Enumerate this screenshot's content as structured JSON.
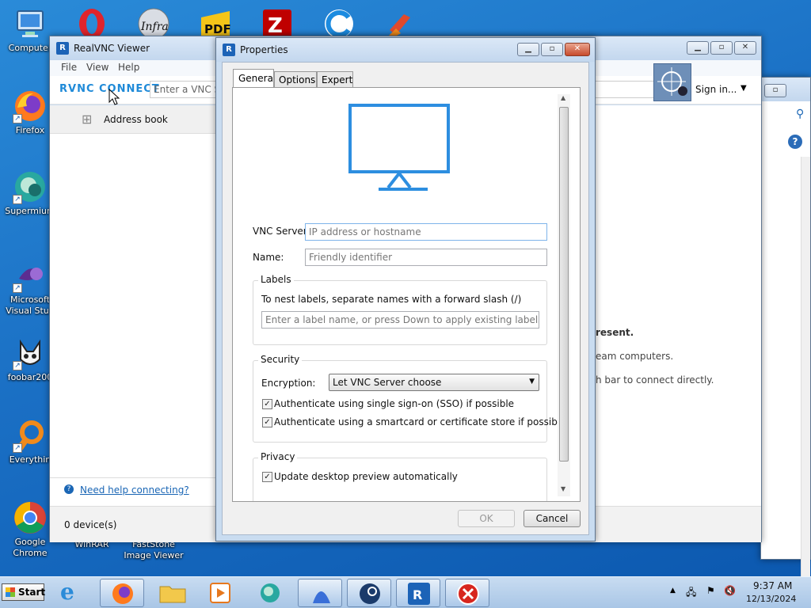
{
  "desktop": {
    "icons": [
      {
        "label": "Computer",
        "glyph": "🖥"
      },
      {
        "label": "Firefox",
        "glyph": ""
      },
      {
        "label": "Supermium",
        "glyph": ""
      },
      {
        "label": "Microsoft Visual Stud",
        "glyph": ""
      },
      {
        "label": "foobar200",
        "glyph": ""
      },
      {
        "label": "Everythin",
        "glyph": ""
      },
      {
        "label": "Google Chrome",
        "glyph": ""
      },
      {
        "label": "WinRAR",
        "glyph": ""
      },
      {
        "label": "FastStone Image Viewer",
        "glyph": ""
      }
    ],
    "top_icons": [
      "opera-icon",
      "infra-icon",
      "pdf-icon",
      "filezilla-icon",
      "ccleaner-browser-icon",
      "ccleaner-icon"
    ]
  },
  "viewer": {
    "title": "RealVNC Viewer",
    "menu": [
      "File",
      "View",
      "Help"
    ],
    "logo": "RVNC CONNECT",
    "search_placeholder": "Enter a VNC Se",
    "address_book": "Address book",
    "sign_in": "Sign in...",
    "help_link": "Need help connecting?",
    "device_count": "0 device(s)",
    "bg_text": [
      "resent.",
      "eam computers.",
      "h bar to connect directly."
    ]
  },
  "dialog": {
    "title": "Properties",
    "tabs": [
      "General",
      "Options",
      "Expert"
    ],
    "active_tab": "General",
    "vnc_server_label": "VNC Server:",
    "vnc_server_placeholder": "IP address or hostname",
    "name_label": "Name:",
    "name_placeholder": "Friendly identifier",
    "labels_group": "Labels",
    "labels_hint": "To nest labels, separate names with a forward slash (/)",
    "labels_placeholder": "Enter a label name, or press Down to apply existing labels",
    "security_group": "Security",
    "encryption_label": "Encryption:",
    "encryption_value": "Let VNC Server choose",
    "sso_label": "Authenticate using single sign-on (SSO) if possible",
    "smartcard_label": "Authenticate using a smartcard or certificate store if possible",
    "privacy_group": "Privacy",
    "preview_label": "Update desktop preview automatically",
    "ok": "OK",
    "cancel": "Cancel"
  },
  "taskbar": {
    "start": "Start",
    "time": "9:37 AM",
    "date": "12/13/2024"
  },
  "colors": {
    "accent": "#1f8ad8",
    "link": "#1a66b5",
    "desktop": "#1a6fc4"
  }
}
